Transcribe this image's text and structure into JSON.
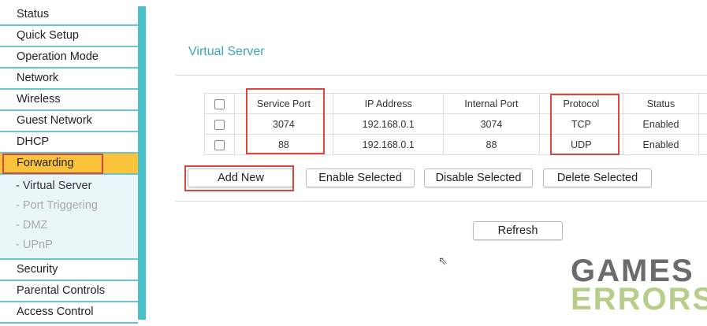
{
  "sidebar": {
    "items": [
      "Status",
      "Quick Setup",
      "Operation Mode",
      "Network",
      "Wireless",
      "Guest Network",
      "DHCP",
      "Forwarding"
    ],
    "submenu": [
      "- Virtual Server",
      "- Port Triggering",
      "- DMZ",
      "- UPnP"
    ],
    "items_after": [
      "Security",
      "Parental Controls",
      "Access Control"
    ]
  },
  "page": {
    "title": "Virtual Server"
  },
  "table": {
    "headers": [
      "Service Port",
      "IP Address",
      "Internal Port",
      "Protocol",
      "Status"
    ],
    "rows": [
      [
        "3074",
        "192.168.0.1",
        "3074",
        "TCP",
        "Enabled"
      ],
      [
        "88",
        "192.168.0.1",
        "88",
        "UDP",
        "Enabled"
      ]
    ]
  },
  "buttons": {
    "add": "Add New",
    "enable": "Enable Selected",
    "disable": "Disable Selected",
    "delete": "Delete Selected",
    "refresh": "Refresh"
  },
  "watermark": {
    "line1": "GAMES",
    "line2": "ERRORS"
  }
}
